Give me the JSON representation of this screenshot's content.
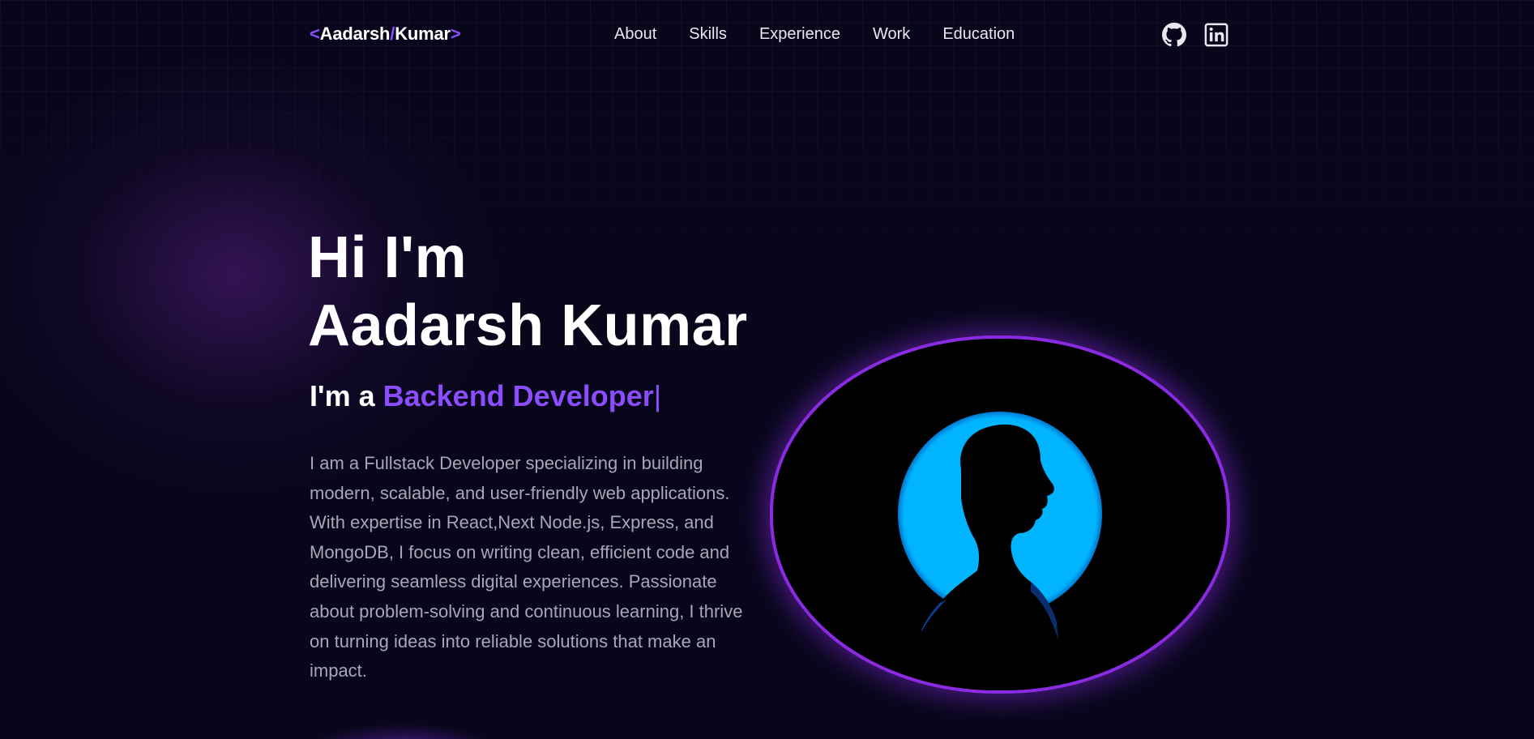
{
  "header": {
    "logo": {
      "open": "<",
      "first": "Aadarsh",
      "slash": "/",
      "last": "Kumar",
      "close": ">"
    },
    "nav": [
      {
        "label": "About"
      },
      {
        "label": "Skills"
      },
      {
        "label": "Experience"
      },
      {
        "label": "Work"
      },
      {
        "label": "Education"
      }
    ],
    "social": {
      "github_icon": "github-icon",
      "linkedin_icon": "linkedin-icon"
    }
  },
  "hero": {
    "greeting": "Hi I'm",
    "name": "Aadarsh Kumar",
    "role_prefix": "I'm a ",
    "role": "Backend Developer",
    "cursor": "|",
    "bio": "I am a Fullstack Developer specializing in building modern, scalable, and user-friendly web applications. With expertise in React,Next Node.js, Express, and MongoDB, I focus on writing clean, efficient code and delivering seamless digital experiences. Passionate about problem-solving and continuous learning, I thrive on turning ideas into reliable solutions that make an impact."
  },
  "colors": {
    "background": "#07061a",
    "accent": "#8b4dff",
    "frame_border": "#8a2be2",
    "silhouette_glow": "#00b4ff",
    "bio_text": "#a7a7b8"
  }
}
